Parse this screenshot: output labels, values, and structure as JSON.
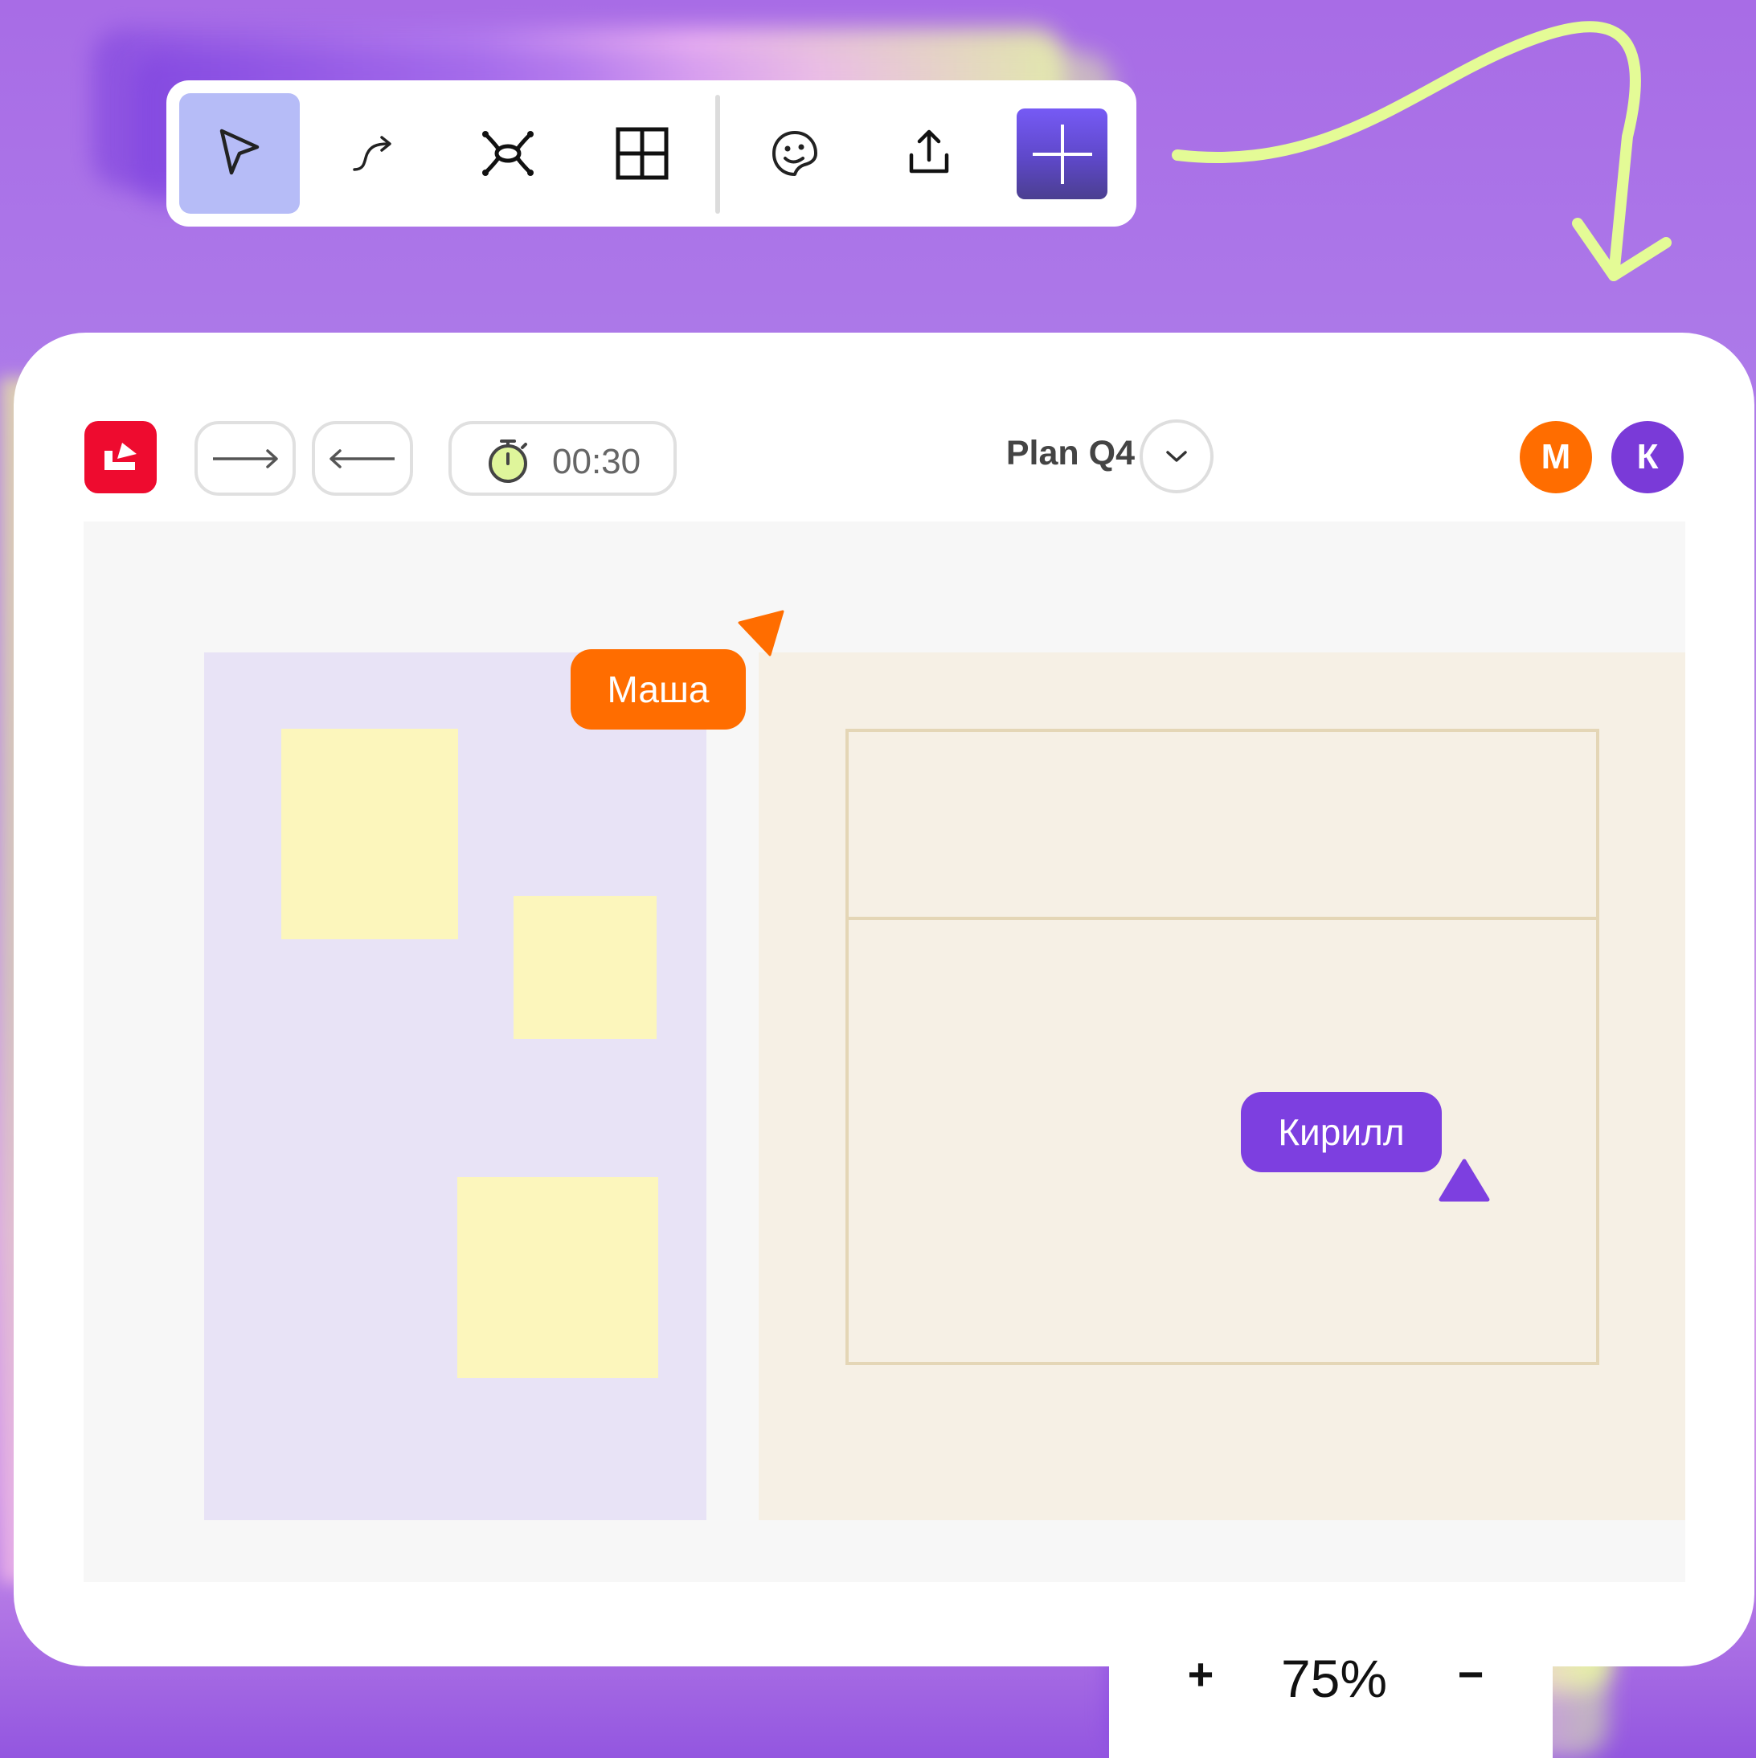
{
  "toolbar": {
    "tools": [
      {
        "name": "select",
        "icon": "cursor-arrow-icon",
        "active": true
      },
      {
        "name": "connector",
        "icon": "curved-arrow-icon",
        "active": false
      },
      {
        "name": "mind-map",
        "icon": "mind-map-icon",
        "active": false
      },
      {
        "name": "table",
        "icon": "grid-icon",
        "active": false
      },
      {
        "name": "sticker",
        "icon": "sticker-icon",
        "active": false
      },
      {
        "name": "export",
        "icon": "upload-icon",
        "active": false
      },
      {
        "name": "add",
        "icon": "plus-icon",
        "active": false
      }
    ],
    "active_color": "#b6bcf7",
    "add_color": "#6a52e0"
  },
  "header": {
    "timer": "00:30",
    "board_title": "Plan Q4",
    "avatars": [
      {
        "initial": "М",
        "color": "#ff6d00"
      },
      {
        "initial": "К",
        "color": "#7a3ad8"
      }
    ]
  },
  "canvas": {
    "collaborators": [
      {
        "name": "Маша",
        "color": "#ff6d00"
      },
      {
        "name": "Кирилл",
        "color": "#7d3fe0"
      }
    ],
    "sticky_color": "#fcf6bc",
    "frame_left_color": "#e8e3f6",
    "frame_right_color": "#f6f0e5"
  },
  "zoom": {
    "zoom_in_label": "+",
    "value": "75%",
    "zoom_out_label": "−"
  }
}
